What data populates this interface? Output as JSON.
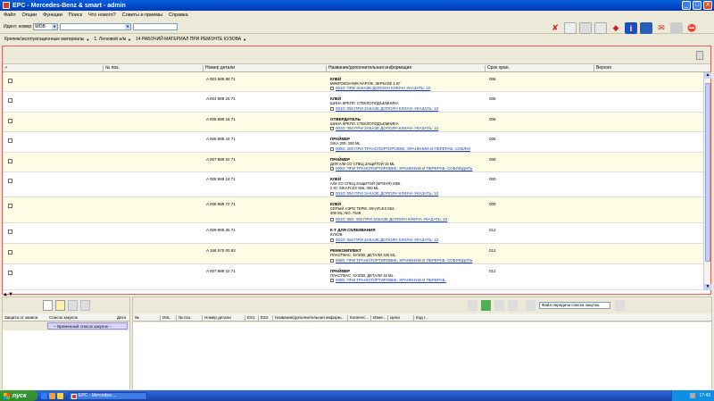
{
  "window": {
    "title": "EPC - Mercedes-Benz & smart - admin",
    "min": "_",
    "max": "□",
    "close": "X"
  },
  "menu": [
    "Файл",
    "Опции",
    "Функции",
    "Поиск",
    "Что нового?",
    "Советы и приемы",
    "Справка"
  ],
  "toolbar": {
    "ident_label": "Идент. номер",
    "ident_value": "WDB",
    "search_value": ""
  },
  "breadcrumb": [
    "Крепеж/эксплуатационные материалы",
    "1. Легковой а/м",
    "14 РАБОЧИЙ МАТЕРИАЛ ПРИ РЕМОНТЕ КУЗОВА"
  ],
  "table": {
    "columns": [
      "✓",
      "№ поз.",
      "Номер детали",
      "Название/дополнительная информация",
      "Срок хран.",
      "Версия"
    ],
    "rows": [
      {
        "part": "A 003 989 88 71",
        "name": "КЛЕЙ",
        "d1": "МИКРОКОНЧИК НАРУЖ. ЗЕРКАЛЕ 1 КГ",
        "d2": "",
        "link": "0010: ПРИ ЗАКАЗЕ ДОПОЛН КЛЮЧА УКАЗАТЬ: 10",
        "life": "006"
      },
      {
        "part": "A 004 989 25 71",
        "name": "КЛЕЙ",
        "d1": "ШИНА КРЕПЛ. СТЕКЛОПОДЪЕМНИКА",
        "d2": "",
        "link": "0010: 050 ПРИ ЗАКАЗЕ ДОПОЛН КЛЮЧА УКАЗАТЬ: 10",
        "life": "006"
      },
      {
        "part": "A 008 989 24 71",
        "name": "ОТВЕРДИТЕЛЬ",
        "d1": "ШИНА КРЕПЛ. СТЕКЛОПОДЪЕМНИКА",
        "d2": "",
        "link": "0010: 050 ПРИ ЗАКАЗЕ ДОПОЛН КЛЮЧА УКАЗАТЬ: 10",
        "life": "006"
      },
      {
        "part": "A 008 989 44 71",
        "name": "ПРАЙМЕР",
        "d1": "SIKA 209; 250 ML",
        "d2": "",
        "link": "0050: 400 ПРИ ТРАНСПОРТИРОВКЕ, ХРАНЕНИИ И ПЕРЕРАБ. СОБЛЮ",
        "life": "006"
      },
      {
        "part": "A 007 989 22 71",
        "name": "ПРАЙМЕР",
        "d1": "ДЛЯ А/М СО СПЕЦ.ЗАЩИТОЙ 15 ML",
        "d2": "",
        "link": "0050: ПРИ ТРАНСПОРТИРОВКЕ, ХРАНЕНИИ И ПЕРЕРАБ. СОБЛЮДАТЬ",
        "life": "000"
      },
      {
        "part": "A 008 989 18 71",
        "name": "КЛЕЙ",
        "d1": "А/М СО СПЕЦ.ЗАЩИТОЙ (БРОНЯ) ИЗВ.",
        "d2": "2 Ю; SIKAFLEX 555; 300 ML",
        "link": "0010: 050 ПРИ ЗАКАЗЕ ДОПОЛН КЛЮЧА УКАЗАТЬ: 10",
        "life": "000"
      },
      {
        "part": "A 008 989 72 71",
        "name": "КЛЕЙ",
        "d1": "СЕРЫЙ АЭРО ТЕРМ. SIKAFLEX 552,",
        "d2": "400 ML; NO. 7546",
        "link": "0010: 050: 400 ПРИ ЗАКАЗЕ ДОПОЛН КЛЮЧА УКАЗАТЬ: 10",
        "life": "000"
      },
      {
        "part": "A 009 989 35 71",
        "name": "К-Т ДЛЯ СКЛЕИВАНИЯ",
        "d1": "КУЗОВ",
        "d2": "",
        "link": "0010: 050 ПРИ ЗАКАЗЕ ДОПОЛН КЛЮЧА УКАЗАТЬ: 12",
        "life": "012"
      },
      {
        "part": "A 168 570 00 93",
        "name": "РЕМКОМПЛЕКТ",
        "d1": "ПЛАСТМАС. КУЗОВ; ДЕТАЛИ 330 ML",
        "d2": "",
        "link": "0050: ПРИ ТРАНСПОРТИРОВКЕ, ХРАНЕНИИ И ПЕРЕРАБ. СОБЛЮДАТЬ",
        "life": "012"
      },
      {
        "part": "A 007 989 22 71",
        "name": "ПРАЙМЕР",
        "d1": "ПЛАСТМАС. КУЗОВ; ДЕТАЛИ 15 ML",
        "d2": "",
        "link": "0050: ПРИ ТРАНСПОРТИРОВКЕ, ХРАНЕНИИ И ПЕРЕРАБ.",
        "life": "012"
      }
    ]
  },
  "left_pane": {
    "columns": [
      "Защита от записи",
      "Список закупок",
      "Дата"
    ],
    "item": "-- Временный список закупок --"
  },
  "right_pane": {
    "combo": "Файл передачи списка закупок",
    "columns": [
      "№",
      "DSL",
      "№ поз.",
      "Номер детали",
      "ES1",
      "ES2",
      "Название/дополнительная информ...",
      "Количес...",
      "Изме...",
      "Цена",
      "Код г..."
    ]
  },
  "taskbar": {
    "start": "пуск",
    "task": "EPC - Mercedes-...",
    "time": "17:43"
  }
}
